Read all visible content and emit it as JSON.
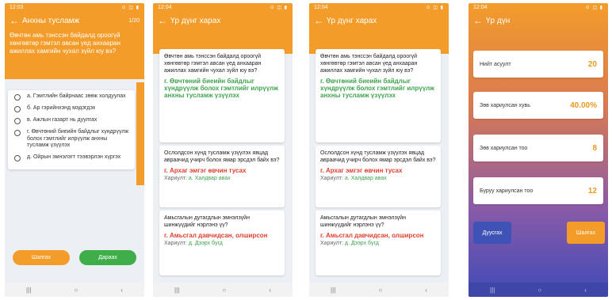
{
  "status": {
    "time1": "12:03",
    "time2": "12:04",
    "time3": "12:04",
    "icons": "⊙ ◫ ▮"
  },
  "screen1": {
    "title": "Анхны тусламж",
    "counter": "1/20",
    "question": "Өвчтөн амь тэнссэн байдалд ороогүй хөнгөвтөр гэмтэл авсан үед анхааран ажиллах хамгийн чухал зүйл юу вэ?",
    "options": [
      "а. Гэмтлийн байрнаас зөөж холдуулах",
      "б. Ар гэрийнхэнд мэдэгдэх",
      "в. Ажлын газарт нь дуулгах",
      "г. Өвчтөний биеийн байдлыг хүндрүүлж болох гэмтлийг илрүүлж анхны тусламж үзүүлэх",
      "д. Ойрын эмнэлэгт тээвэрлэн хүргэх"
    ],
    "btn_prev": "Шалгах",
    "btn_next": "Дараах"
  },
  "review": {
    "title": "Үр дүнг харах",
    "q1": "Өвчтөн амь тэнссэн байдалд ороогүй хөнгөвтөр гэмтэл авсан үед анхааран ажиллах хамгийн чухал зүйл юу вэ?",
    "a1": "г. Өвчтөний биеийн байдлыг хүндрүүлж болох гэмтлийг илрүүлж анхны тусламж үзүүлэх",
    "q2": "Ослолдсон хүнд тусламж үзүүлэх явцад авраачид учирч болох ямар эрсдэл байх вэ?",
    "a2": "г. Архаг эмгэг өвчин тусах",
    "ans_label": "Хариулт:",
    "ans2": "а. Халдвар авах",
    "q3": "Амьсгалын дутагдлын эмнэлзүйн шинжүүдийг нэрлэнэ үү?",
    "a3": "г. Амьсгал давчидсан, олширсон",
    "ans3": "д. Дээрх бүгд"
  },
  "result": {
    "title": "Үр дүн",
    "rows": [
      {
        "label": "Нийт асуулт",
        "value": "20"
      },
      {
        "label": "Зөв хариулсан хувь",
        "value": "40.00%"
      },
      {
        "label": "Зөв хариулсан тоо",
        "value": "8"
      },
      {
        "label": "Буруу хариулсан тоо",
        "value": "12"
      }
    ],
    "btn_finish": "Дуусгах",
    "btn_check": "Шалгах"
  },
  "nav": {
    "recent": "|||",
    "home": "○",
    "back": "‹"
  },
  "colors": {
    "accent": "#f39c2a",
    "green": "#3fae49",
    "red": "#e0402f",
    "blue": "#3f52b5"
  }
}
